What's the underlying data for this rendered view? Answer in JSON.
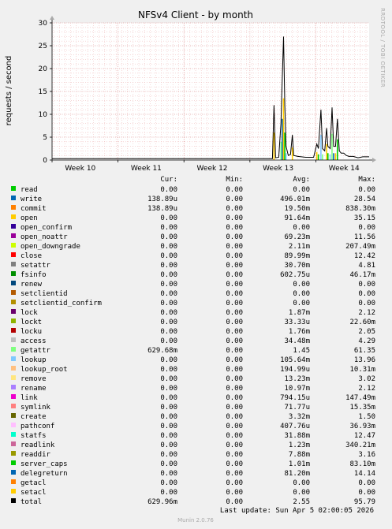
{
  "chart_data": {
    "type": "line",
    "title": "NFSv4 Client - by month",
    "ylabel": "requests / second",
    "xlabel": "",
    "ylim": [
      0,
      30
    ],
    "yticks": [
      0,
      5,
      10,
      15,
      20,
      25,
      30
    ],
    "xticks": [
      "Week 10",
      "Week 11",
      "Week 12",
      "Week 13",
      "Week 14"
    ],
    "side_label": "RRDTOOL / TOBI OETIKER",
    "columns": [
      "Cur:",
      "Min:",
      "Avg:",
      "Max:"
    ],
    "total_series": {
      "name": "total",
      "points": [
        [
          0.0,
          0.3
        ],
        [
          0.695,
          0.3
        ],
        [
          0.7,
          12.0
        ],
        [
          0.705,
          0.5
        ],
        [
          0.715,
          0.6
        ],
        [
          0.722,
          8.0
        ],
        [
          0.726,
          18.0
        ],
        [
          0.73,
          27.0
        ],
        [
          0.734,
          12.0
        ],
        [
          0.738,
          3.0
        ],
        [
          0.745,
          1.0
        ],
        [
          0.752,
          1.2
        ],
        [
          0.758,
          5.5
        ],
        [
          0.762,
          1.0
        ],
        [
          0.775,
          0.8
        ],
        [
          0.8,
          0.6
        ],
        [
          0.825,
          0.6
        ],
        [
          0.835,
          3.5
        ],
        [
          0.84,
          2.5
        ],
        [
          0.848,
          11.0
        ],
        [
          0.853,
          2.5
        ],
        [
          0.86,
          2.0
        ],
        [
          0.866,
          7.0
        ],
        [
          0.87,
          3.0
        ],
        [
          0.877,
          2.5
        ],
        [
          0.883,
          11.5
        ],
        [
          0.888,
          3.0
        ],
        [
          0.894,
          3.0
        ],
        [
          0.9,
          9.0
        ],
        [
          0.906,
          2.0
        ],
        [
          0.912,
          1.5
        ],
        [
          0.92,
          1.5
        ],
        [
          0.928,
          1.0
        ],
        [
          0.936,
          0.8
        ],
        [
          0.95,
          0.8
        ],
        [
          0.965,
          0.5
        ],
        [
          0.98,
          0.7
        ],
        [
          1.0,
          0.7
        ]
      ]
    },
    "rows": [
      {
        "name": "read",
        "color": "#00cc00",
        "cur": "0.00",
        "min": "0.00",
        "avg": "0.00",
        "max": "0.00"
      },
      {
        "name": "write",
        "color": "#0066b3",
        "cur": "138.89u",
        "min": "0.00",
        "avg": "496.01m",
        "max": "28.54"
      },
      {
        "name": "commit",
        "color": "#ff8000",
        "cur": "138.89u",
        "min": "0.00",
        "avg": "19.50m",
        "max": "838.30m"
      },
      {
        "name": "open",
        "color": "#ffcc00",
        "cur": "0.00",
        "min": "0.00",
        "avg": "91.64m",
        "max": "35.15"
      },
      {
        "name": "open_confirm",
        "color": "#330099",
        "cur": "0.00",
        "min": "0.00",
        "avg": "0.00",
        "max": "0.00"
      },
      {
        "name": "open_noattr",
        "color": "#990099",
        "cur": "0.00",
        "min": "0.00",
        "avg": "69.23m",
        "max": "11.56"
      },
      {
        "name": "open_downgrade",
        "color": "#ccff00",
        "cur": "0.00",
        "min": "0.00",
        "avg": "2.11m",
        "max": "207.49m"
      },
      {
        "name": "close",
        "color": "#ff0000",
        "cur": "0.00",
        "min": "0.00",
        "avg": "89.99m",
        "max": "12.42"
      },
      {
        "name": "setattr",
        "color": "#808080",
        "cur": "0.00",
        "min": "0.00",
        "avg": "30.70m",
        "max": "4.81"
      },
      {
        "name": "fsinfo",
        "color": "#008f00",
        "cur": "0.00",
        "min": "0.00",
        "avg": "602.75u",
        "max": "46.17m"
      },
      {
        "name": "renew",
        "color": "#00487d",
        "cur": "0.00",
        "min": "0.00",
        "avg": "0.00",
        "max": "0.00"
      },
      {
        "name": "setclientid",
        "color": "#b35a00",
        "cur": "0.00",
        "min": "0.00",
        "avg": "0.00",
        "max": "0.00"
      },
      {
        "name": "setclientid_confirm",
        "color": "#b38f00",
        "cur": "0.00",
        "min": "0.00",
        "avg": "0.00",
        "max": "0.00"
      },
      {
        "name": "lock",
        "color": "#6b006b",
        "cur": "0.00",
        "min": "0.00",
        "avg": "1.87m",
        "max": "2.12"
      },
      {
        "name": "lockt",
        "color": "#8fb300",
        "cur": "0.00",
        "min": "0.00",
        "avg": "33.33u",
        "max": "22.60m"
      },
      {
        "name": "locku",
        "color": "#b30000",
        "cur": "0.00",
        "min": "0.00",
        "avg": "1.76m",
        "max": "2.05"
      },
      {
        "name": "access",
        "color": "#bebebe",
        "cur": "0.00",
        "min": "0.00",
        "avg": "34.48m",
        "max": "4.29"
      },
      {
        "name": "getattr",
        "color": "#80ff80",
        "cur": "629.68m",
        "min": "0.00",
        "avg": "1.45",
        "max": "61.35"
      },
      {
        "name": "lookup",
        "color": "#80c9ff",
        "cur": "0.00",
        "min": "0.00",
        "avg": "105.64m",
        "max": "13.96"
      },
      {
        "name": "lookup_root",
        "color": "#ffc080",
        "cur": "0.00",
        "min": "0.00",
        "avg": "194.99u",
        "max": "10.31m"
      },
      {
        "name": "remove",
        "color": "#ffe680",
        "cur": "0.00",
        "min": "0.00",
        "avg": "13.23m",
        "max": "3.02"
      },
      {
        "name": "rename",
        "color": "#aa80ff",
        "cur": "0.00",
        "min": "0.00",
        "avg": "10.97m",
        "max": "2.12"
      },
      {
        "name": "link",
        "color": "#ee00cc",
        "cur": "0.00",
        "min": "0.00",
        "avg": "794.15u",
        "max": "147.49m"
      },
      {
        "name": "symlink",
        "color": "#ff8080",
        "cur": "0.00",
        "min": "0.00",
        "avg": "71.77u",
        "max": "15.35m"
      },
      {
        "name": "create",
        "color": "#666600",
        "cur": "0.00",
        "min": "0.00",
        "avg": "3.32m",
        "max": "1.50"
      },
      {
        "name": "pathconf",
        "color": "#ffbfff",
        "cur": "0.00",
        "min": "0.00",
        "avg": "407.76u",
        "max": "36.93m"
      },
      {
        "name": "statfs",
        "color": "#00ffcc",
        "cur": "0.00",
        "min": "0.00",
        "avg": "31.88m",
        "max": "12.47"
      },
      {
        "name": "readlink",
        "color": "#cc6699",
        "cur": "0.00",
        "min": "0.00",
        "avg": "1.23m",
        "max": "340.21m"
      },
      {
        "name": "readdir",
        "color": "#999900",
        "cur": "0.00",
        "min": "0.00",
        "avg": "7.88m",
        "max": "3.16"
      },
      {
        "name": "server_caps",
        "color": "#00cc00",
        "cur": "0.00",
        "min": "0.00",
        "avg": "1.01m",
        "max": "83.10m"
      },
      {
        "name": "delegreturn",
        "color": "#0066b3",
        "cur": "0.00",
        "min": "0.00",
        "avg": "81.20m",
        "max": "14.14"
      },
      {
        "name": "getacl",
        "color": "#ff8000",
        "cur": "0.00",
        "min": "0.00",
        "avg": "0.00",
        "max": "0.00"
      },
      {
        "name": "setacl",
        "color": "#ffcc00",
        "cur": "0.00",
        "min": "0.00",
        "avg": "0.00",
        "max": "0.00"
      },
      {
        "name": "total",
        "color": "#000000",
        "cur": "629.96m",
        "min": "0.00",
        "avg": "2.55",
        "max": "95.79"
      }
    ],
    "last_update": "Last update: Sun Apr  5 02:00:05 2026",
    "footer": "Munin 2.0.76"
  }
}
